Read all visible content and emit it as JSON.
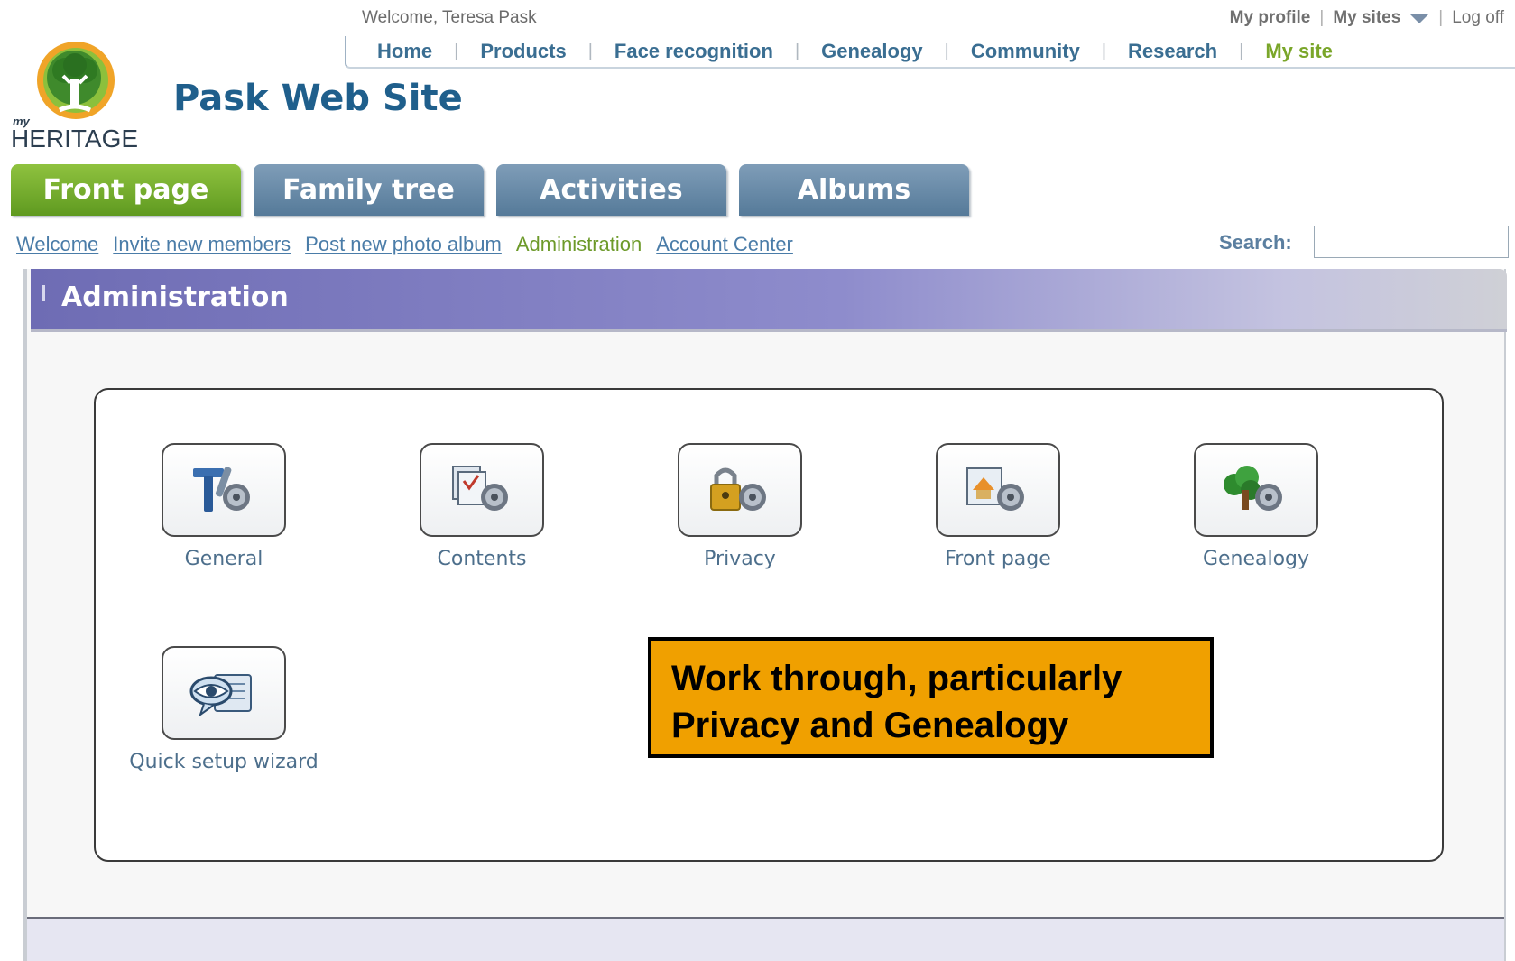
{
  "header": {
    "welcome": "Welcome, Teresa Pask",
    "utility": {
      "my_profile": "My profile",
      "my_sites": "My sites",
      "log_off": "Log off",
      "sep": "|"
    },
    "nav": [
      {
        "label": "Home"
      },
      {
        "label": "Products"
      },
      {
        "label": "Face recognition"
      },
      {
        "label": "Genealogy"
      },
      {
        "label": "Community"
      },
      {
        "label": "Research"
      },
      {
        "label": "My site"
      }
    ],
    "nav_sep": "|",
    "logo": {
      "small": "my",
      "word": "HERITAGE"
    },
    "site_title": "Pask Web Site"
  },
  "main_tabs": [
    {
      "label": "Front page",
      "active": true
    },
    {
      "label": "Family tree"
    },
    {
      "label": "Activities"
    },
    {
      "label": "Albums"
    }
  ],
  "subnav": [
    {
      "label": "Welcome"
    },
    {
      "label": "Invite new members"
    },
    {
      "label": "Post new photo album"
    },
    {
      "label": "Administration",
      "current": true
    },
    {
      "label": "Account Center"
    }
  ],
  "search": {
    "label": "Search:",
    "value": ""
  },
  "admin": {
    "title": "Administration",
    "tiles": [
      {
        "label": "General",
        "icon": "tools-gear-icon"
      },
      {
        "label": "Contents",
        "icon": "documents-gear-icon"
      },
      {
        "label": "Privacy",
        "icon": "padlock-gear-icon"
      },
      {
        "label": "Front page",
        "icon": "home-page-gear-icon"
      },
      {
        "label": "Genealogy",
        "icon": "tree-gear-icon"
      },
      {
        "label": "Quick setup wizard",
        "icon": "eye-wizard-icon"
      }
    ]
  },
  "callout": {
    "line1": "Work through, particularly",
    "line2": "Privacy and Genealogy"
  },
  "colors": {
    "green_tab": "#6fa82a",
    "blue_tab": "#6a8aa8",
    "callout_bg": "#f0a000",
    "admin_header": "#7c7ac2",
    "link": "#4a7ca8"
  }
}
